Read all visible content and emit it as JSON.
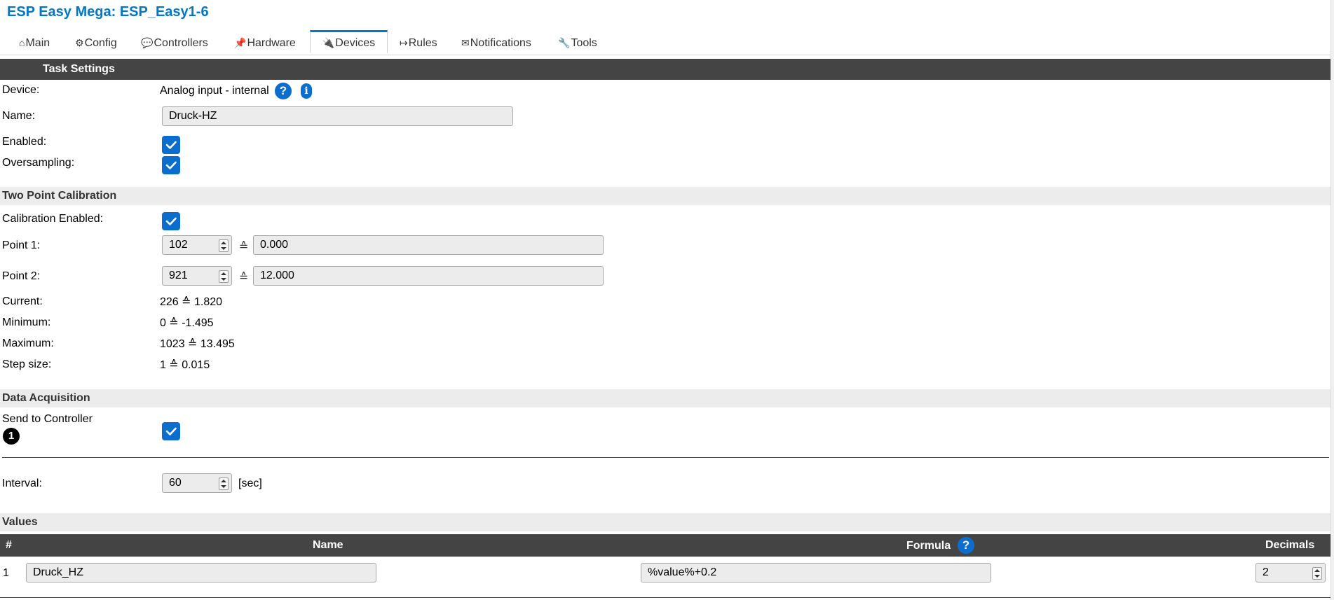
{
  "app": {
    "title": "ESP Easy Mega: ESP_Easy1-6"
  },
  "tabs": [
    {
      "icon": "⌂",
      "label": "Main"
    },
    {
      "icon": "⚙",
      "label": "Config"
    },
    {
      "icon": "💬",
      "label": "Controllers"
    },
    {
      "icon": "📌",
      "label": "Hardware"
    },
    {
      "icon": "🔌",
      "label": "Devices"
    },
    {
      "icon": "↦",
      "label": "Rules"
    },
    {
      "icon": "✉",
      "label": "Notifications"
    },
    {
      "icon": "🔧",
      "label": "Tools"
    }
  ],
  "active_tab": "Devices",
  "task_settings": {
    "header": "Task Settings",
    "device_label": "Device:",
    "device_value": "Analog input - internal",
    "name_label": "Name:",
    "name_value": "Druck-HZ",
    "enabled_label": "Enabled:",
    "enabled": true,
    "oversampling_label": "Oversampling:",
    "oversampling": true
  },
  "calibration": {
    "header": "Two Point Calibration",
    "enabled_label": "Calibration Enabled:",
    "enabled": true,
    "equiv_symbol": "≙",
    "point1_label": "Point 1:",
    "point1_raw": "102",
    "point1_value": "0.000",
    "point2_label": "Point 2:",
    "point2_raw": "921",
    "point2_value": "12.000",
    "current_label": "Current:",
    "current_value": "226 ≙ 1.820",
    "minimum_label": "Minimum:",
    "minimum_value": "0 ≙ -1.495",
    "maximum_label": "Maximum:",
    "maximum_value": "1023 ≙ 13.495",
    "step_label": "Step size:",
    "step_value": "1 ≙ 0.015"
  },
  "acquisition": {
    "header": "Data Acquisition",
    "send_label": "Send to Controller",
    "controller_number": "1",
    "send_enabled": true,
    "interval_label": "Interval:",
    "interval_value": "60",
    "interval_unit": "[sec]"
  },
  "values": {
    "header": "Values",
    "col_num": "#",
    "col_name": "Name",
    "col_formula": "Formula",
    "col_decimals": "Decimals",
    "rows": [
      {
        "num": "1",
        "name": "Druck_HZ",
        "formula": "%value%+0.2",
        "decimals": "2"
      }
    ]
  },
  "icons": {
    "help": "question-circle-icon",
    "info": "info-icon",
    "checkbox": "checkmark-icon"
  },
  "colors": {
    "accent": "#0b6ecf",
    "title": "#0077c8",
    "header_bg": "#444444",
    "section_bg": "#ececec"
  }
}
